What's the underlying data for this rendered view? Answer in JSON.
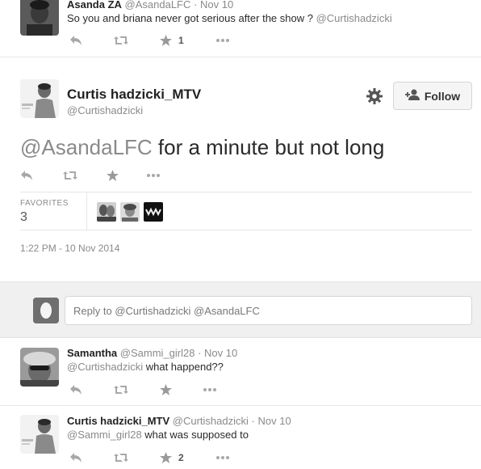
{
  "top_tweet": {
    "name": "Asanda ZA",
    "handle": "@AsandaLFC",
    "separator": "·",
    "time": "Nov 10",
    "text": "So you and briana never got serious after the show ?",
    "mention": "@Curtishadzicki",
    "favorite_count": "1",
    "icons": [
      "reply-icon",
      "retweet-icon",
      "favorite-icon",
      "more-icon"
    ]
  },
  "main_tweet": {
    "name": "Curtis hadzicki_MTV",
    "handle": "@Curtishadzicki",
    "follow_label": "Follow",
    "mention": "@AsandaLFC",
    "text": " for a minute but not long",
    "favorites_label": "FAVORITES",
    "favorites_count": "3",
    "timestamp": "1:22 PM - 10 Nov 2014",
    "icons": [
      "gear-icon",
      "follow-person-icon",
      "reply-icon",
      "retweet-icon",
      "favorite-icon",
      "more-icon"
    ]
  },
  "reply_box": {
    "value": "Reply to @Curtishadzicki @AsandaLFC"
  },
  "replies": [
    {
      "name": "Samantha",
      "handle": "@Sammi_girl28",
      "separator": "·",
      "time": "Nov 10",
      "mention": "@Curtishadzicki",
      "text": " what happend??"
    },
    {
      "name": "Curtis hadzicki_MTV",
      "handle": "@Curtishadzicki",
      "separator": "·",
      "time": "Nov 10",
      "mention": "@Sammi_girl28",
      "text": " what was supposed to",
      "favorite_count": "2"
    }
  ],
  "colors": {
    "text": "#2a2a2a",
    "muted": "#8a8a8a",
    "divider": "#e6e6e6",
    "reply_bg": "#f0f0f0"
  }
}
